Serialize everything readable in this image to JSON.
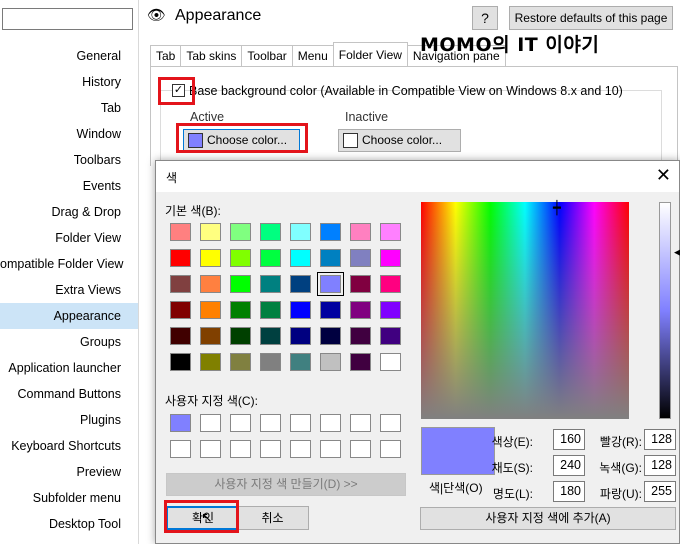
{
  "sidebar": {
    "items": [
      {
        "label": "General"
      },
      {
        "label": "History"
      },
      {
        "label": "Tab"
      },
      {
        "label": "Window"
      },
      {
        "label": "Toolbars"
      },
      {
        "label": "Events"
      },
      {
        "label": "Drag & Drop"
      },
      {
        "label": "Folder View"
      },
      {
        "label": "ompatible Folder View"
      },
      {
        "label": "Extra Views"
      },
      {
        "label": "Appearance",
        "selected": true
      },
      {
        "label": "Groups"
      },
      {
        "label": "Application launcher"
      },
      {
        "label": "Command Buttons"
      },
      {
        "label": "Plugins"
      },
      {
        "label": "Keyboard Shortcuts"
      },
      {
        "label": "Preview"
      },
      {
        "label": "Subfolder menu"
      },
      {
        "label": "Desktop Tool"
      }
    ]
  },
  "header": {
    "icon": "eye-icon",
    "icon_glyph": "👁",
    "title": "Appearance",
    "help_label": "?",
    "restore_label": "Restore defaults of this page"
  },
  "tabs": [
    {
      "label": "Tab"
    },
    {
      "label": "Tab skins"
    },
    {
      "label": "Toolbar"
    },
    {
      "label": "Menu"
    },
    {
      "label": "Folder View",
      "active": true
    },
    {
      "label": "Navigation pane"
    }
  ],
  "watermark": "MOMO의 IT 이야기",
  "options": {
    "base_bg_checked": true,
    "check_glyph": "✓",
    "base_bg_label": "Base background color (Available in Compatible View on Windows 8.x and 10)",
    "active_label": "Active",
    "inactive_label": "Inactive",
    "active_choose_label": "Choose color...",
    "active_color": "#8080ff",
    "inactive_choose_label": "Choose color...",
    "inactive_color": "#ffffff"
  },
  "color_dialog": {
    "title": "색",
    "close_glyph": "✕",
    "basic_colors_label": "기본 색(B):",
    "custom_colors_label": "사용자 지정 색(C):",
    "basic_colors": [
      "#ff8080",
      "#ffff80",
      "#80ff80",
      "#00ff80",
      "#80ffff",
      "#0080ff",
      "#ff80c0",
      "#ff80ff",
      "#ff0000",
      "#ffff00",
      "#80ff00",
      "#00ff40",
      "#00ffff",
      "#0080c0",
      "#8080c0",
      "#ff00ff",
      "#804040",
      "#ff8040",
      "#00ff00",
      "#008080",
      "#004080",
      "#8080ff",
      "#800040",
      "#ff0080",
      "#800000",
      "#ff8000",
      "#008000",
      "#008040",
      "#0000ff",
      "#0000a0",
      "#800080",
      "#8000ff",
      "#400000",
      "#804000",
      "#004000",
      "#004040",
      "#000080",
      "#000040",
      "#400040",
      "#400080",
      "#000000",
      "#808000",
      "#808040",
      "#808080",
      "#408080",
      "#c0c0c0",
      "#400040",
      "#ffffff"
    ],
    "selected_basic_index": 21,
    "custom_colors": [
      "#8080ff",
      "#ffffff",
      "#ffffff",
      "#ffffff",
      "#ffffff",
      "#ffffff",
      "#ffffff",
      "#ffffff",
      "#ffffff",
      "#ffffff",
      "#ffffff",
      "#ffffff",
      "#ffffff",
      "#ffffff",
      "#ffffff",
      "#ffffff"
    ],
    "define_custom_label": "사용자 지정 색 만들기(D) >>",
    "ok_label": "확인",
    "cancel_label": "취소",
    "cursor_glyph": "↖",
    "crosshair_glyph": "┿",
    "lum_arrow_glyph": "◀",
    "preview_color": "#8080ff",
    "preview_label": "색|단색(O)",
    "fields": {
      "hue_label": "색상(E):",
      "hue": "160",
      "sat_label": "채도(S):",
      "sat": "240",
      "lum_label": "명도(L):",
      "lum": "180",
      "red_label": "빨강(R):",
      "red": "128",
      "green_label": "녹색(G):",
      "green": "128",
      "blue_label": "파랑(U):",
      "blue": "255"
    },
    "add_custom_label": "사용자 지정 색에 추가(A)"
  }
}
